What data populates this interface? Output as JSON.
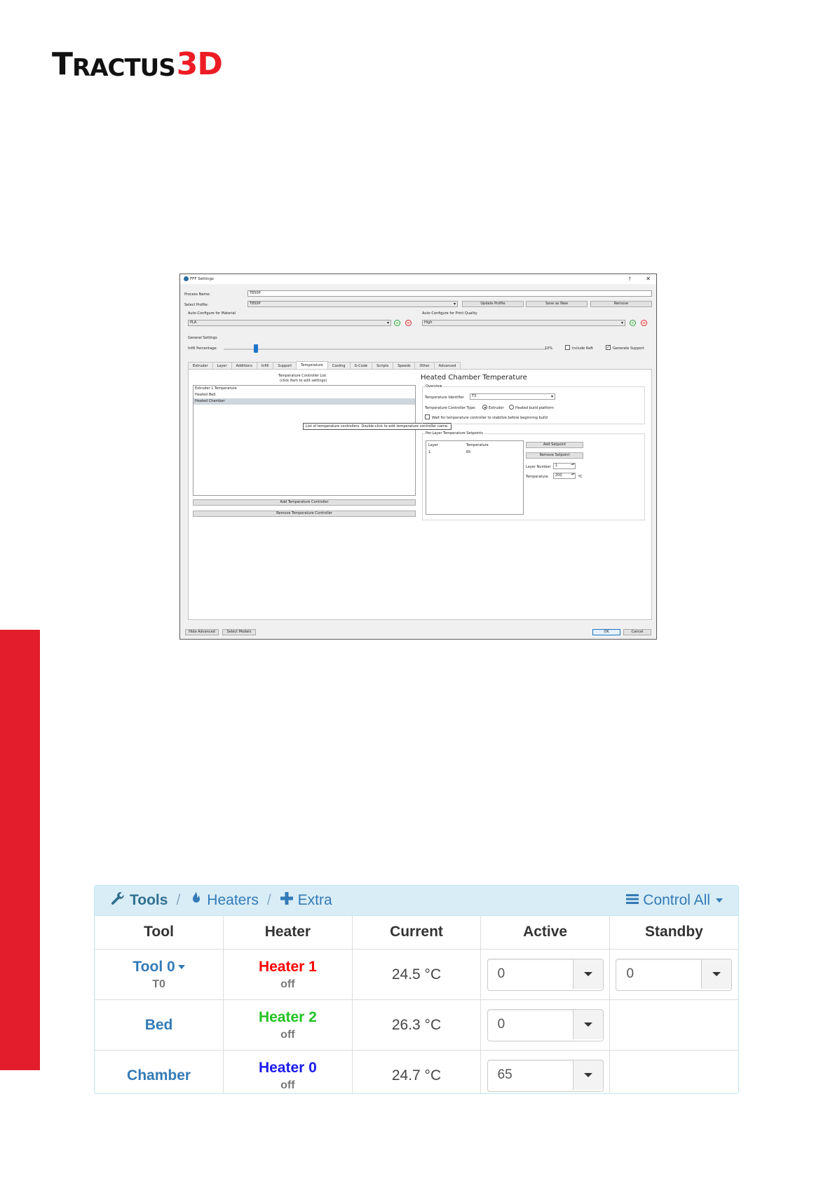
{
  "logo": {
    "t": "T",
    "rest": "RACTUS",
    "three_d": "3D"
  },
  "dialog": {
    "title": "FFF Settings",
    "help": "?",
    "close": "✕",
    "process_name_label": "Process Name:",
    "process_name_value": "T850P",
    "select_profile_label": "Select Profile:",
    "select_profile_value": "T850P",
    "update_profile": "Update Profile",
    "save_as_new": "Save as New",
    "remove": "Remove",
    "auto_material_label": "Auto-Configure for Material",
    "material_value": "PLA",
    "auto_quality_label": "Auto-Configure for Print Quality",
    "quality_value": "High",
    "general_settings": "General Settings",
    "infill_label": "Infill Percentage:",
    "infill_value_text": "10%",
    "infill_fraction": 0.1,
    "include_raft": "Include Raft",
    "generate_support": "Generate Support",
    "tabs": [
      "Extruder",
      "Layer",
      "Additions",
      "Infill",
      "Support",
      "Temperature",
      "Cooling",
      "G-Code",
      "Scripts",
      "Speeds",
      "Other",
      "Advanced"
    ],
    "list_title_1": "Temperature Controller List",
    "list_title_2": "(click item to edit settings)",
    "list_items": [
      "Extruder 1 Temperature",
      "Heated Bed",
      "Heated Chamber"
    ],
    "tooltip": "List of temperature controllers.  Double-click to edit temperature controller name.",
    "add_controller": "Add Temperature Controller",
    "remove_controller": "Remove Temperature Controller",
    "right_title": "Heated Chamber Temperature",
    "overview": "Overview",
    "identifier_label": "Temperature Identifier",
    "identifier_value": "T3",
    "controller_type_label": "Temperature Controller Type:",
    "type_extruder": "Extruder",
    "type_platform": "Heated build platform",
    "wait_label": "Wait for temperature controller to stabilize before beginning build",
    "setpoints_title": "Per-Layer Temperature Setpoints",
    "sp_col_layer": "Layer",
    "sp_col_temp": "Temperature",
    "sp_layer": "1",
    "sp_temp": "65",
    "add_setpoint": "Add Setpoint",
    "remove_setpoint": "Remove Setpoint",
    "layer_number_label": "Layer Number",
    "layer_number_value": "1",
    "temperature_label": "Temperature",
    "temperature_value": "200",
    "temperature_unit": "ºC",
    "hide_advanced": "Hide Advanced",
    "select_models": "Select Models",
    "ok": "OK",
    "cancel": "Cancel"
  },
  "widget": {
    "crumbs": {
      "tools": "Tools",
      "sep": "/",
      "heaters": "Heaters",
      "extra": "Extra"
    },
    "control_all": "Control All",
    "columns": [
      "Tool",
      "Heater",
      "Current",
      "Active",
      "Standby"
    ],
    "rows": [
      {
        "tool": "Tool 0",
        "sub": "T0",
        "heater": "Heater 1",
        "heater_color": "#ff0000",
        "state": "off",
        "current": "24.5 °C",
        "active": "0",
        "standby": "0"
      },
      {
        "tool": "Bed",
        "sub": "",
        "heater": "Heater 2",
        "heater_color": "#22c322",
        "state": "off",
        "current": "26.3 °C",
        "active": "0",
        "standby": ""
      },
      {
        "tool": "Chamber",
        "sub": "",
        "heater": "Heater 0",
        "heater_color": "#1a1aee",
        "state": "off",
        "current": "24.7 °C",
        "active": "65",
        "standby": ""
      }
    ]
  }
}
